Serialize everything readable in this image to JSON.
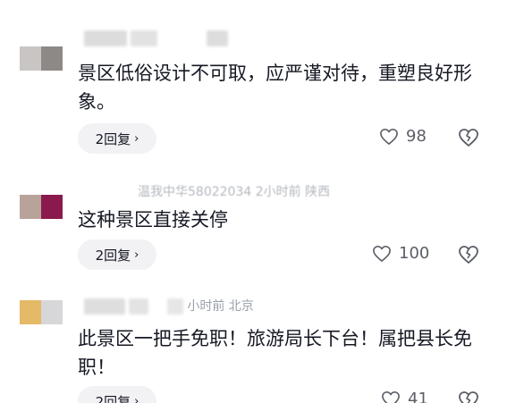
{
  "comments": [
    {
      "avatar_colors": [
        "#c9c5c4",
        "#8d8986"
      ],
      "meta": "",
      "text": "景区低俗设计不可取，应严谨对待，重塑良好形象。",
      "reply_label": "2回复",
      "likes": "98"
    },
    {
      "avatar_colors": [
        "#b8a39a",
        "#8a1a4e"
      ],
      "meta": "温我中华58022034  2小时前  陕西",
      "text": "这种景区直接关停",
      "reply_label": "2回复",
      "likes": "100"
    },
    {
      "avatar_colors": [
        "#e4b968",
        "#d7d6d8"
      ],
      "meta": "小时前  北京",
      "text": "此景区一把手免职！旅游局长下台！属把县长免职！",
      "reply_label": "2回复",
      "likes": "41"
    }
  ],
  "colors": {
    "text": "#161823",
    "meta": "#9aa0a8",
    "reply_bg": "#f2f2f4",
    "icon": "#5b5e66"
  },
  "icons": [
    "heart-outline-icon",
    "broken-heart-icon",
    "chevron-right-icon"
  ]
}
